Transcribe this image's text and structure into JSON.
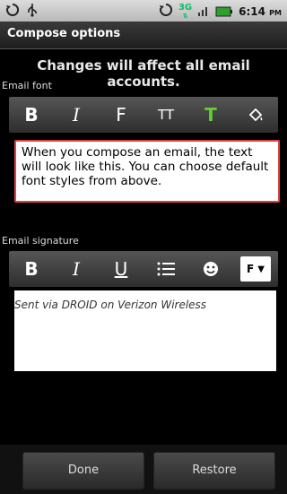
{
  "status": {
    "time": "6:14",
    "ampm": "PM",
    "network": "3G"
  },
  "header": {
    "title": "Compose options"
  },
  "notice": "Changes will affect all email accounts.",
  "font_section": {
    "label": "Email font",
    "preview": "When you compose an email, the text will look like this. You can choose default font styles from above.",
    "buttons": [
      "B",
      "I",
      "F",
      "TT",
      "T"
    ]
  },
  "signature_section": {
    "label": "Email signature",
    "text": "Sent via DROID on Verizon Wireless",
    "buttons": [
      "B",
      "I",
      "U",
      "F"
    ]
  },
  "actions": {
    "done": "Done",
    "restore": "Restore"
  },
  "colors": {
    "green": "#6c3",
    "accent": "#d44"
  }
}
